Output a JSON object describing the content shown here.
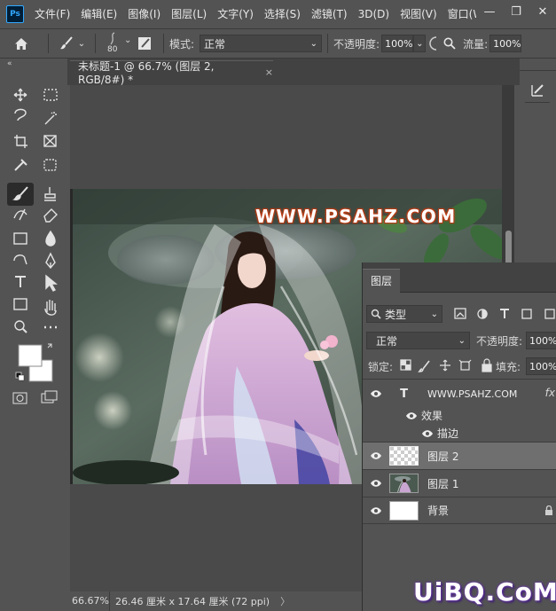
{
  "app": {
    "logo": "Ps",
    "window_controls": [
      "—",
      "❐",
      "✕"
    ]
  },
  "menu": [
    "文件(F)",
    "编辑(E)",
    "图像(I)",
    "图层(L)",
    "文字(Y)",
    "选择(S)",
    "滤镜(T)",
    "3D(D)",
    "视图(V)",
    "窗口(W"
  ],
  "options": {
    "brush_size": "80",
    "mode_label": "模式:",
    "mode_value": "正常",
    "opacity_label": "不透明度:",
    "opacity_value": "100%",
    "flow_label": "流量:",
    "flow_value": "100%"
  },
  "document": {
    "tab_title": "未标题-1 @ 66.7% (图层 2, RGB/8#) *",
    "close": "×",
    "canvas_text": "WWW.PSAHZ.COM"
  },
  "status": {
    "zoom": "66.67%",
    "doc_size": "26.46 厘米 x 17.64 厘米 (72 ppi)",
    "arrow": "〉"
  },
  "layers_panel": {
    "tab": "图层",
    "filter_value": "类型",
    "blend_mode": "正常",
    "opacity_label": "不透明度:",
    "opacity_value": "100%",
    "lock_label": "锁定:",
    "fill_label": "填充:",
    "fill_value": "100%",
    "text_layer": {
      "type_glyph": "T",
      "name": "WWW.PSAHZ.COM",
      "fx": "fx"
    },
    "effects_label": "效果",
    "stroke_label": "描边",
    "layer2": "图层 2",
    "layer1": "图层 1",
    "background": "背景"
  },
  "site_mark": "UiBQ.CoM",
  "colors": {
    "panel": "#535353",
    "dark": "#424242",
    "selected_row": "#6f6f6f",
    "accent_blue": "#31a8ff"
  }
}
